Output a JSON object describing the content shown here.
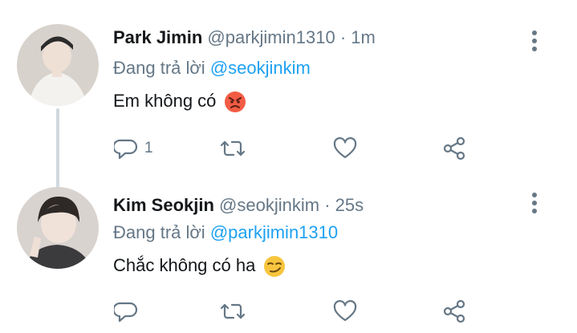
{
  "tweets": [
    {
      "name": "Park Jimin",
      "handle": "@parkjimin1310",
      "separator": "·",
      "time": "1m",
      "replying_prefix": "Đang trả lời",
      "replying_to": "@seokjinkim",
      "text": "Em không có",
      "emoji": "angry-face",
      "reply_count": "1",
      "avatar_bg": "#d8d2cc"
    },
    {
      "name": "Kim Seokjin",
      "handle": "@seokjinkim",
      "separator": "·",
      "time": "25s",
      "replying_prefix": "Đang trả lời",
      "replying_to": "@parkjimin1310",
      "text": "Chắc không có ha",
      "emoji": "smirking-face",
      "reply_count": "",
      "avatar_bg": "#d9d3cf"
    }
  ],
  "colors": {
    "accent": "#1da1f2",
    "secondary_text": "#657786",
    "primary_text": "#14171a",
    "thread_line": "#cfd9de"
  }
}
